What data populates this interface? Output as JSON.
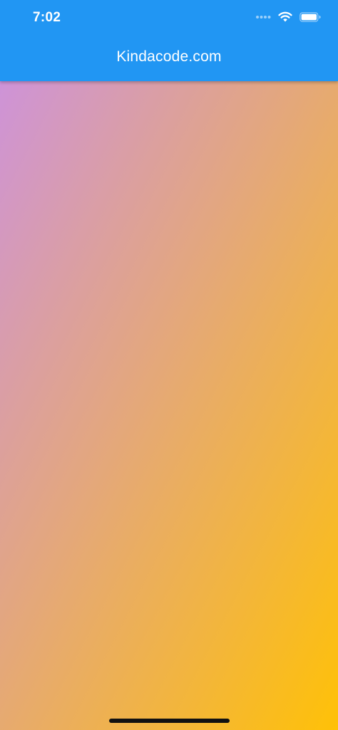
{
  "status_bar": {
    "time": "7:02",
    "icons": [
      "signal-icon",
      "wifi-icon",
      "battery-icon"
    ]
  },
  "app_bar": {
    "title": "Kindacode.com"
  },
  "colors": {
    "app_bar": "#2196F3",
    "gradient_start": "#CE93D8",
    "gradient_end": "#FFC107",
    "status_text": "#FFFFFF",
    "home_indicator": "#111111"
  }
}
